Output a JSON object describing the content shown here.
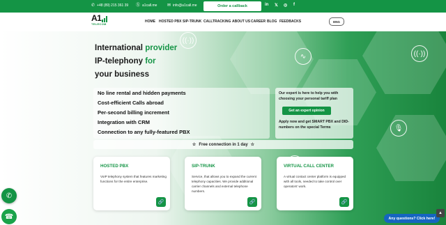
{
  "topbar": {
    "phone": "+48 (89) 215 361 39",
    "skype": "a1call.me",
    "email": "info@a1call.me",
    "callback_label": "Order a callback",
    "social": [
      {
        "icon": "linkedin-icon",
        "glyph": "in"
      },
      {
        "icon": "twitter-icon",
        "glyph": "𝕏"
      },
      {
        "icon": "instagram-icon",
        "glyph": "◎"
      },
      {
        "icon": "facebook-icon",
        "glyph": "f"
      }
    ]
  },
  "logo": {
    "main": "A1",
    "sub": "TELECOM"
  },
  "nav": {
    "items": [
      "HOME",
      "HOSTED PBX",
      "SIP-TRUNK",
      "CALLTRACKING",
      "ABOUT US",
      "CAREER",
      "BLOG",
      "FEEDBACKS"
    ],
    "lang": "ENG"
  },
  "hero": {
    "title_line1_a": "International ",
    "title_line1_b": "provider",
    "title_line2_a": "IP-telephony ",
    "title_line2_b": "for",
    "title_line3": "your business",
    "features": [
      "No line rental and hidden payments",
      "Cost-efficient Calls abroad",
      "Per-second billing increment",
      "Integration with CRM",
      "Connection to any fully-featured PBX"
    ],
    "expert_text": "Our expert is here to help you with choosing your personal tariff plan",
    "expert_button": "Get an expert opinion",
    "apply_text": "Apply now and get SMART PBX and DID-numbers on the special Terms",
    "free_connection": "Free connection in 1 day"
  },
  "cards": [
    {
      "title": "HOSTED PBX",
      "desc": "VoIP telephony system that features marketing functions for the entire enterprise."
    },
    {
      "title": "SIP-TRUNK",
      "desc": "Service, that allows you to expand the current telephony capacities. We provide additional carrier channels and external telephone numbers."
    },
    {
      "title": "VIRTUAL CALL CENTER",
      "desc": "A virtual contact center platform is equipped with all tools, needed to take control over operators' work."
    }
  ],
  "widgets": {
    "chat_label": "Any questions? Click here!"
  },
  "colors": {
    "brand_green": "#149445",
    "chat_blue": "#1565c0"
  }
}
